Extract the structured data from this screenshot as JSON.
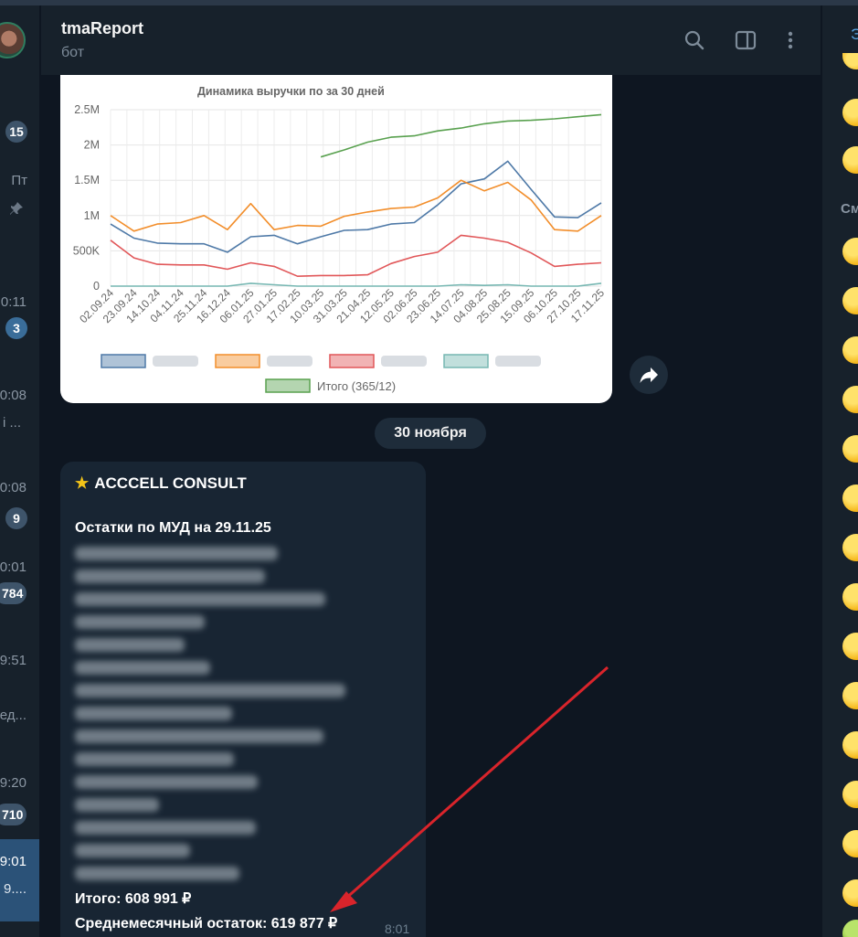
{
  "header": {
    "title": "tmaReport",
    "subtitle": "бот"
  },
  "left_list": {
    "times": [
      "Пт",
      "0:11",
      "0:08",
      "0:08",
      "0:01",
      "9:51",
      "9:20",
      "9:01"
    ],
    "snippets": [
      "і ...",
      "ед...",
      "9...."
    ],
    "badges": [
      "15",
      "3",
      "9",
      "784",
      "710"
    ]
  },
  "chart_data": {
    "type": "line",
    "title": "Динамика выручки по за 30 дней",
    "x": [
      "02.09.24",
      "23.09.24",
      "14.10.24",
      "04.11.24",
      "25.11.24",
      "16.12.24",
      "06.01.25",
      "27.01.25",
      "17.02.25",
      "10.03.25",
      "31.03.25",
      "21.04.25",
      "12.05.25",
      "02.06.25",
      "23.06.25",
      "14.07.25",
      "04.08.25",
      "25.08.25",
      "15.09.25",
      "06.10.25",
      "27.10.25",
      "17.11.25"
    ],
    "yticks": [
      "0",
      "500K",
      "1M",
      "1.5M",
      "2M",
      "2.5M"
    ],
    "ylim": [
      0,
      2500000
    ],
    "series": [
      {
        "name": "",
        "color": "#4e79a7",
        "values": [
          880000,
          680000,
          610000,
          600000,
          600000,
          480000,
          700000,
          720000,
          600000,
          700000,
          790000,
          800000,
          880000,
          900000,
          1150000,
          1450000,
          1520000,
          1770000,
          1370000,
          980000,
          970000,
          1180000
        ]
      },
      {
        "name": "",
        "color": "#f28e2b",
        "values": [
          1000000,
          780000,
          880000,
          900000,
          1000000,
          800000,
          1170000,
          800000,
          860000,
          850000,
          990000,
          1050000,
          1100000,
          1120000,
          1250000,
          1500000,
          1350000,
          1470000,
          1220000,
          800000,
          780000,
          1000000
        ]
      },
      {
        "name": "",
        "color": "#e15759",
        "values": [
          650000,
          400000,
          310000,
          300000,
          300000,
          240000,
          330000,
          280000,
          140000,
          150000,
          150000,
          160000,
          320000,
          420000,
          480000,
          720000,
          680000,
          620000,
          470000,
          280000,
          310000,
          330000
        ]
      },
      {
        "name": "",
        "color": "#76b7b2",
        "values": [
          0,
          0,
          0,
          0,
          0,
          0,
          40000,
          20000,
          0,
          0,
          0,
          0,
          0,
          0,
          0,
          20000,
          10000,
          20000,
          0,
          0,
          0,
          40000
        ]
      },
      {
        "name": "Итого (365/12)",
        "color": "#59a14f",
        "values": [
          null,
          null,
          null,
          null,
          null,
          null,
          null,
          null,
          null,
          1830000,
          1930000,
          2040000,
          2110000,
          2130000,
          2200000,
          2240000,
          2300000,
          2340000,
          2350000,
          2370000,
          2400000,
          2430000
        ]
      }
    ],
    "legend_placement": "bottom",
    "grid": true
  },
  "date_separator": "30 ноября",
  "message": {
    "star_icon": "star",
    "header": "ACCCELL CONSULT",
    "subtitle": "Остатки по МУД на 29.11.25",
    "total": "Итого: 608 991 ₽",
    "average": "Среднемесячный остаток: 619 877 ₽",
    "time": "8:01"
  },
  "emoji_panel": {
    "tab_label": "Э",
    "section_label": "См"
  },
  "colors": {
    "accent": "#5da8e8",
    "annotation_arrow": "#d9242b"
  }
}
